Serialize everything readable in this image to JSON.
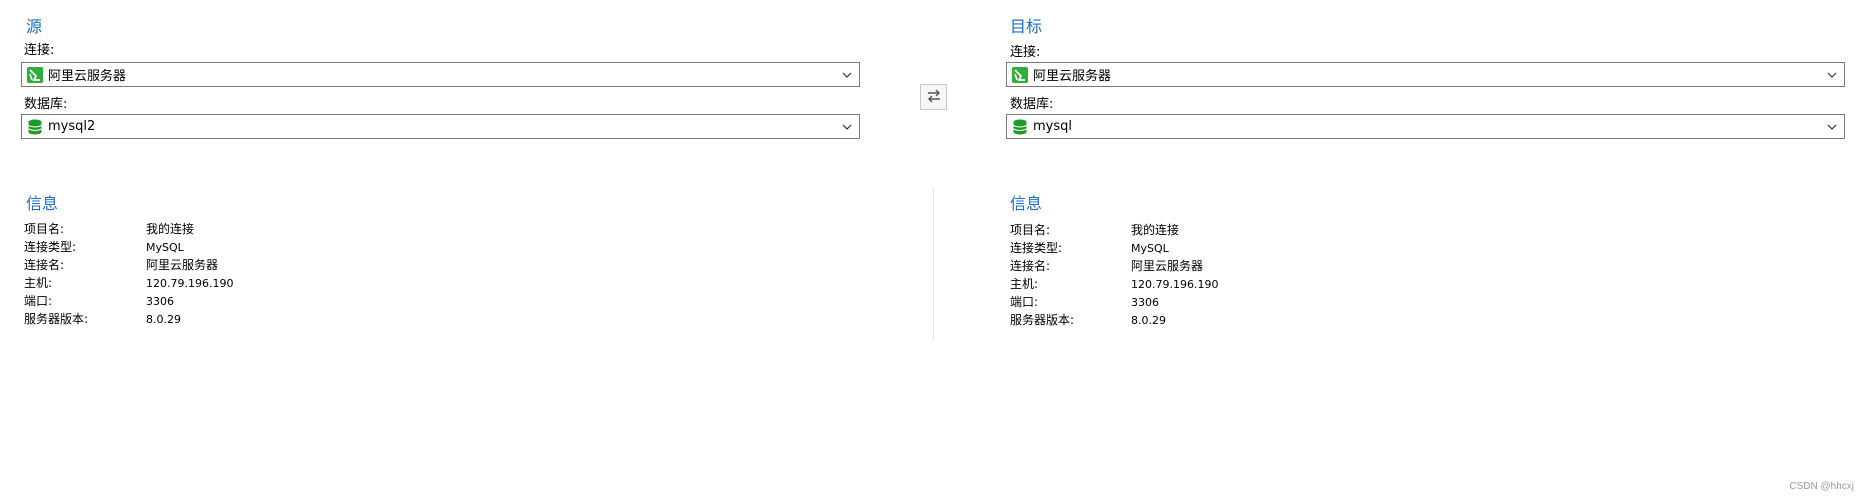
{
  "source": {
    "title": "源",
    "connection_label": "连接:",
    "connection_value": "阿里云服务器",
    "database_label": "数据库:",
    "database_value": "mysql2"
  },
  "target": {
    "title": "目标",
    "connection_label": "连接:",
    "connection_value": "阿里云服务器",
    "database_label": "数据库:",
    "database_value": "mysql"
  },
  "swap_button": {
    "icon": "swap-arrows-icon"
  },
  "source_info": {
    "title": "信息",
    "rows": [
      {
        "key": "项目名:",
        "value": "我的连接"
      },
      {
        "key": "连接类型:",
        "value": "MySQL"
      },
      {
        "key": "连接名:",
        "value": "阿里云服务器"
      },
      {
        "key": "主机:",
        "value": "120.79.196.190"
      },
      {
        "key": "端口:",
        "value": "3306"
      },
      {
        "key": "服务器版本:",
        "value": "8.0.29"
      }
    ]
  },
  "target_info": {
    "title": "信息",
    "rows": [
      {
        "key": "项目名:",
        "value": "我的连接"
      },
      {
        "key": "连接类型:",
        "value": "MySQL"
      },
      {
        "key": "连接名:",
        "value": "阿里云服务器"
      },
      {
        "key": "主机:",
        "value": "120.79.196.190"
      },
      {
        "key": "端口:",
        "value": "3306"
      },
      {
        "key": "服务器版本:",
        "value": "8.0.29"
      }
    ]
  },
  "watermark": "CSDN @hhcxj",
  "colors": {
    "accent_title": "#1a6fc4",
    "connection_icon_green": "#2fae3b",
    "database_icon_green": "#1f9a2c"
  }
}
